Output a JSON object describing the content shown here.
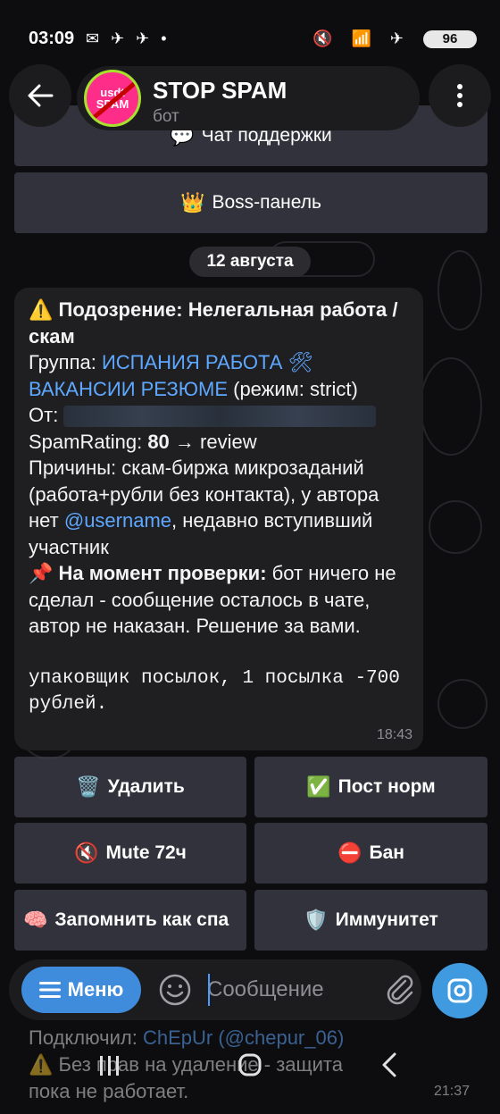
{
  "status_bar": {
    "time": "03:09",
    "left_icons": "✉ ✈ ✈ •",
    "right_icons": "🔇 📶 ✈",
    "battery": "96"
  },
  "header": {
    "avatar_text": "usdt SPAM",
    "title": "STOP SPAM",
    "subtitle": "бот",
    "back_icon": "arrow-left-icon",
    "menu_icon": "more-vertical-icon"
  },
  "top_keyboard": [
    {
      "emoji": "💬",
      "label": "Чат поддержки"
    },
    {
      "emoji": "👑",
      "label": "Boss-панель"
    }
  ],
  "date_chip": "12 августа",
  "message": {
    "line1_emoji": "⚠️",
    "title": "Подозрение: Нелегальная работа / скам",
    "group_label": "Группа:",
    "group_name": "ИСПАНИЯ РАБОТА 🛠",
    "group_name2": "ВАКАНСИИ РЕЗЮМЕ",
    "group_mode": "(режим: strict)",
    "from_label": "От:",
    "rating_label": "SpamRating:",
    "rating_value": "80",
    "rating_action": "→ review",
    "reasons_label": "Причины:",
    "reasons_text": "скам-биржа микрозаданий (работа+рубли без контакта), у автора нет",
    "reasons_link": "@username",
    "reasons_tail": ", недавно вступивший участник",
    "check_emoji": "📌",
    "check_label": "На момент проверки:",
    "check_text": "бот ничего не сделал - сообщение осталось в чате, автор не наказан. Решение за вами.",
    "quoted": "упаковщик посылок, 1 посылка -700 рублей.",
    "time": "18:43"
  },
  "actions": [
    {
      "emoji": "🗑️",
      "label": "Удалить"
    },
    {
      "emoji": "✅",
      "label": "Пост норм"
    },
    {
      "emoji": "🔇",
      "label": "Mute 72ч"
    },
    {
      "emoji": "⛔",
      "label": "Бан"
    },
    {
      "emoji": "🧠",
      "label": "Запомнить как спа"
    },
    {
      "emoji": "🛡️",
      "label": "Иммунитет"
    }
  ],
  "input": {
    "menu_label": "Меню",
    "placeholder": "Сообщение"
  },
  "behind_text": {
    "line1_label": "Подключил:",
    "line1_name": "ChEpUr",
    "line1_handle": "(@chepur_06)",
    "line2": "⚠️ Без прав на удаление - защита",
    "line3": "пока не работает.",
    "time": "21:37"
  },
  "colors": {
    "accent": "#3f8bdc",
    "link": "#5ea8ff",
    "bubble": "#1f1f22",
    "button": "#3c3e48"
  }
}
